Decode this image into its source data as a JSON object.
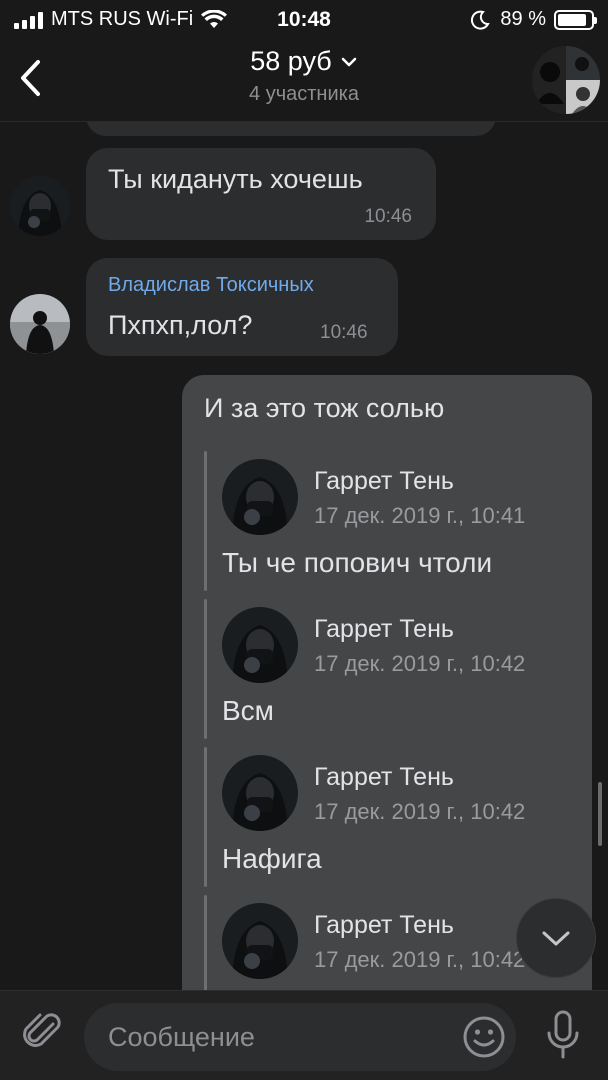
{
  "status_bar": {
    "carrier": "MTS RUS Wi-Fi",
    "time": "10:48",
    "battery": "89 %",
    "battery_level": 0.89
  },
  "header": {
    "title": "58 руб",
    "subtitle": "4 участника"
  },
  "messages": [
    {
      "text": "Ты кидануть хочешь",
      "time": "10:46"
    },
    {
      "sender": "Владислав Токсичных",
      "text": "Пхпхп,лол?",
      "time": "10:46"
    }
  ],
  "outgoing": {
    "text": "И за это тож солью",
    "forwards": [
      {
        "name": "Гаррет Тень",
        "date": "17 дек. 2019 г., 10:41",
        "text": "Ты че попович чтоли"
      },
      {
        "name": "Гаррет Тень",
        "date": "17 дек. 2019 г., 10:42",
        "text": "Всм"
      },
      {
        "name": "Гаррет Тень",
        "date": "17 дек. 2019 г., 10:42",
        "text": "Нафига"
      },
      {
        "name": "Гаррет Тень",
        "date": "17 дек. 2019 г., 10:42",
        "text": ""
      }
    ]
  },
  "composer": {
    "placeholder": "Сообщение"
  },
  "icons": {
    "back": "chevron-left-icon",
    "dropdown": "chevron-down-icon",
    "attach": "paperclip-icon",
    "emoji": "smiley-icon",
    "mic": "microphone-icon",
    "scroll_down": "chevron-down-icon"
  }
}
